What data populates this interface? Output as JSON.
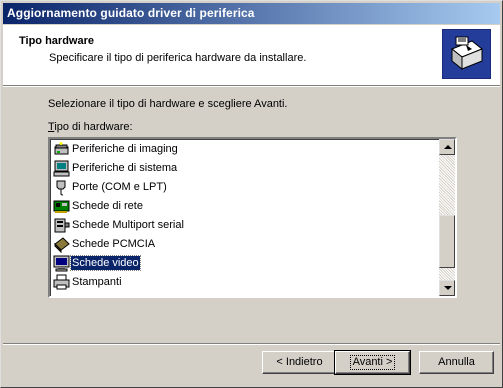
{
  "window": {
    "title": "Aggiornamento guidato driver di periferica"
  },
  "header": {
    "title": "Tipo hardware",
    "subtitle": "Specificare il tipo di periferica hardware da installare.",
    "icon": "hardware-wizard-icon"
  },
  "body": {
    "instruction": "Selezionare il tipo di hardware e scegliere Avanti.",
    "list_label": "Tipo di hardware:"
  },
  "hardware_list": {
    "selected": "Schede video",
    "items": [
      {
        "label": "Periferiche di imaging",
        "icon": "scanner-icon"
      },
      {
        "label": "Periferiche di sistema",
        "icon": "system-device-icon"
      },
      {
        "label": "Porte (COM e LPT)",
        "icon": "port-icon"
      },
      {
        "label": "Schede di rete",
        "icon": "network-card-icon"
      },
      {
        "label": "Schede Multiport serial",
        "icon": "multiport-card-icon"
      },
      {
        "label": "Schede PCMCIA",
        "icon": "pcmcia-card-icon"
      },
      {
        "label": "Schede video",
        "icon": "display-adapter-icon"
      },
      {
        "label": "Stampanti",
        "icon": "printer-icon"
      }
    ]
  },
  "buttons": {
    "back": "< Indietro",
    "next": "Avanti >",
    "cancel": "Annulla"
  },
  "colors": {
    "selection": "#0a246a",
    "title_gradient_start": "#0a246a",
    "title_gradient_end": "#a6caf0",
    "face": "#d4d0c8"
  }
}
